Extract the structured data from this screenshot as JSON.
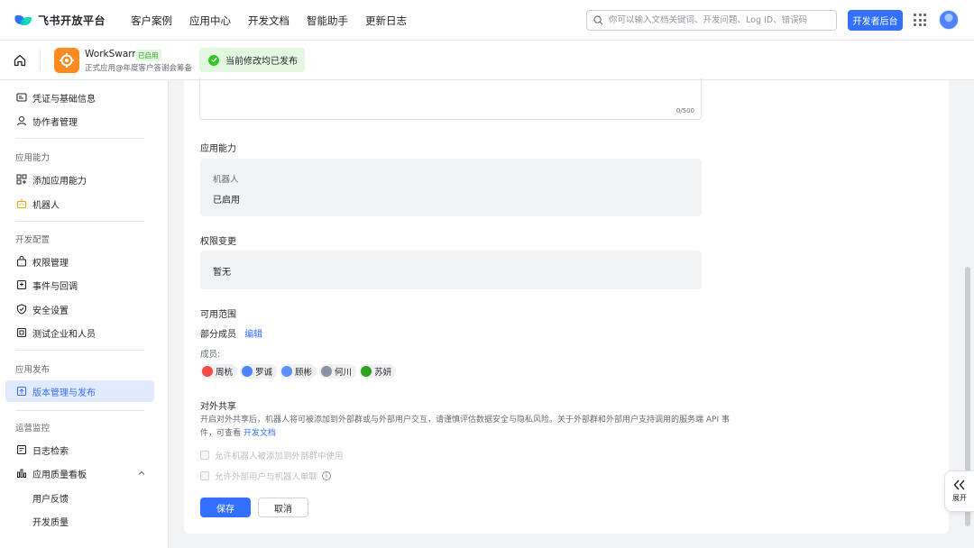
{
  "topnav": {
    "brand": "飞书开放平台",
    "links": [
      "客户案例",
      "应用中心",
      "开发文档",
      "智能助手",
      "更新日志"
    ],
    "search_placeholder": "你可以输入文档关键词、开发问题、Log ID、错误码",
    "dev_button": "开发者后台"
  },
  "appbar": {
    "app_name": "WorkSwarm",
    "app_tag": "已启用",
    "app_desc": "正式应用@年度客户答谢会筹备",
    "toast": "当前修改均已发布"
  },
  "sidebar": {
    "credentials": "凭证与基础信息",
    "collaborators": "协作者管理",
    "section_capability": "应用能力",
    "add_capability": "添加应用能力",
    "bot": "机器人",
    "section_dev": "开发配置",
    "permissions": "权限管理",
    "events": "事件与回调",
    "security": "安全设置",
    "test_org": "测试企业和人员",
    "section_release": "应用发布",
    "version": "版本管理与发布",
    "section_ops": "运营监控",
    "logs": "日志检索",
    "quality": "应用质量看板",
    "feedback": "用户反馈",
    "dev_quality": "开发质量"
  },
  "main": {
    "counter": "0/500",
    "capability_label": "应用能力",
    "capability_name": "机器人",
    "capability_status": "已启用",
    "perm_label": "权限变更",
    "perm_value": "暂无",
    "scope_label": "可用范围",
    "scope_value": "部分成员",
    "scope_edit": "编辑",
    "members_label": "成员:",
    "members": [
      "周杭",
      "罗诚",
      "顾彬",
      "何川",
      "苏妍"
    ],
    "share_label": "对外共享",
    "share_desc": "开启对外共享后，机器人将可被添加到外部群或与外部用户交互，请谨慎评估数据安全与隐私风险。关于外部群和外部用户支持调用的服务端 API 事件，可查看 ",
    "share_link": "开发文档",
    "check1": "允许机器人被添加到外部群中使用",
    "check2": "允许外部用户与机器人单聊",
    "save": "保存",
    "cancel": "取消",
    "expand": "展开"
  },
  "colors": {
    "accent": "#3370ff",
    "success": "#34c724",
    "app_icon": "#ff8a1f"
  }
}
